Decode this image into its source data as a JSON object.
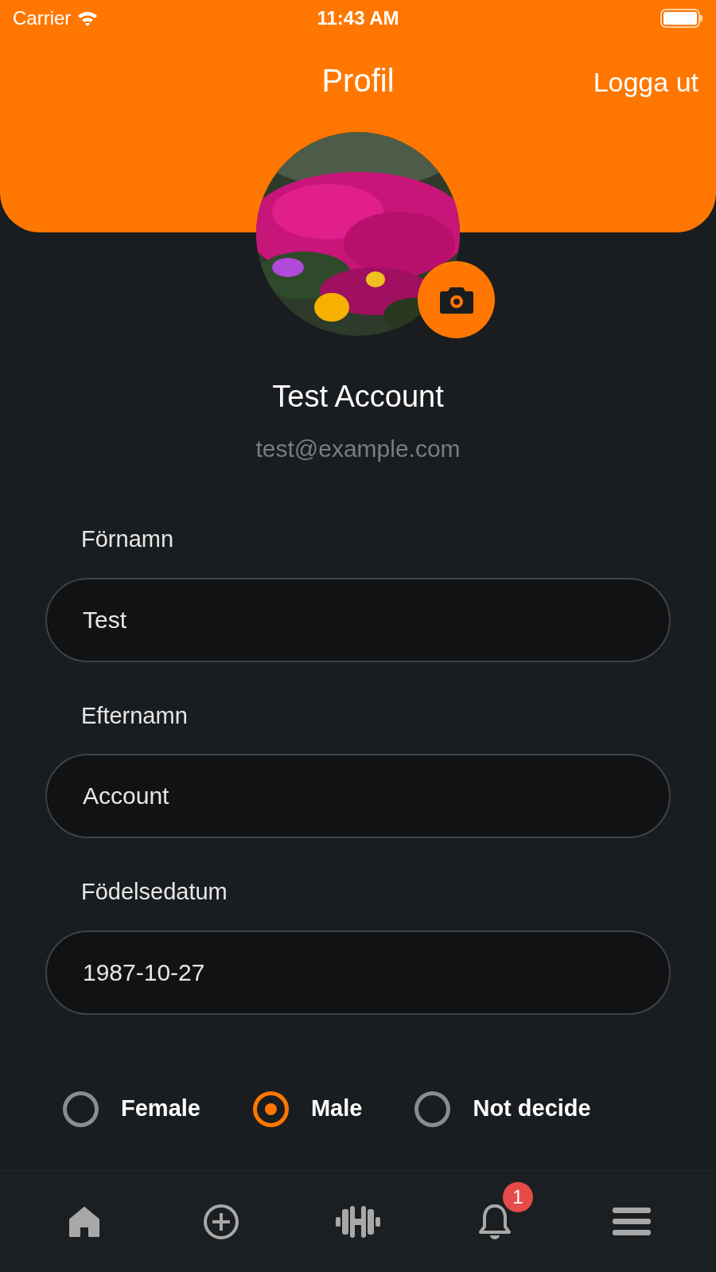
{
  "status_bar": {
    "carrier": "Carrier",
    "time": "11:43 AM"
  },
  "header": {
    "title": "Profil",
    "action": "Logga ut"
  },
  "profile": {
    "name": "Test Account",
    "email": "test@example.com"
  },
  "fields": [
    {
      "label": "Förnamn",
      "value": "Test"
    },
    {
      "label": "Efternamn",
      "value": "Account"
    },
    {
      "label": "Födelsedatum",
      "value": "1987-10-27"
    }
  ],
  "gender": [
    {
      "label": "Female",
      "selected": false
    },
    {
      "label": "Male",
      "selected": true
    },
    {
      "label": "Not decide",
      "selected": false
    }
  ],
  "tab_bar": {
    "notification_badge": "1"
  }
}
